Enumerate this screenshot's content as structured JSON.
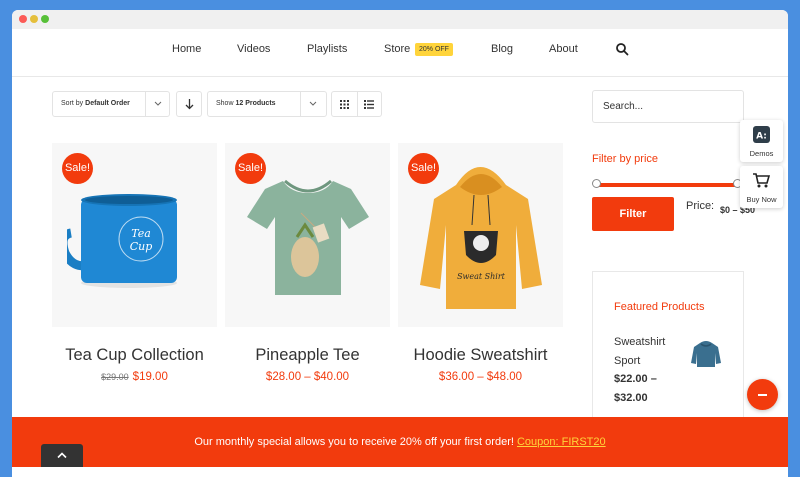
{
  "nav": {
    "items": [
      "Home",
      "Videos",
      "Playlists",
      "Store",
      "Blog",
      "About"
    ],
    "store_badge": "20% OFF"
  },
  "toolbar": {
    "sort_prefix": "Sort by",
    "sort_value": "Default Order",
    "show_prefix": "Show",
    "show_value": "12 Products"
  },
  "products": [
    {
      "title": "Tea Cup Collection",
      "badge": "Sale!",
      "old_price": "$29.00",
      "price": "$19.00"
    },
    {
      "title": "Pineapple Tee",
      "badge": "Sale!",
      "price": "$28.00 – $40.00"
    },
    {
      "title": "Hoodie Sweatshirt",
      "badge": "Sale!",
      "price": "$36.00 – $48.00"
    }
  ],
  "sidebar": {
    "search_placeholder": "Search...",
    "filter_title": "Filter by price",
    "filter_button": "Filter",
    "price_label": "Price:",
    "price_range": "$0 – $50",
    "featured_title": "Featured Products",
    "featured_item": {
      "name": "Sweatshirt Sport",
      "price": "$22.00 – $32.00"
    }
  },
  "side_buttons": {
    "demos": "Demos",
    "buy_now": "Buy Now"
  },
  "promo": {
    "text": "Our monthly special allows you to receive 20% off your first order! ",
    "coupon": "Coupon: FIRST20"
  },
  "colors": {
    "accent": "#f23b0d",
    "badge": "#ffd43b",
    "background": "#4a8fe0"
  }
}
